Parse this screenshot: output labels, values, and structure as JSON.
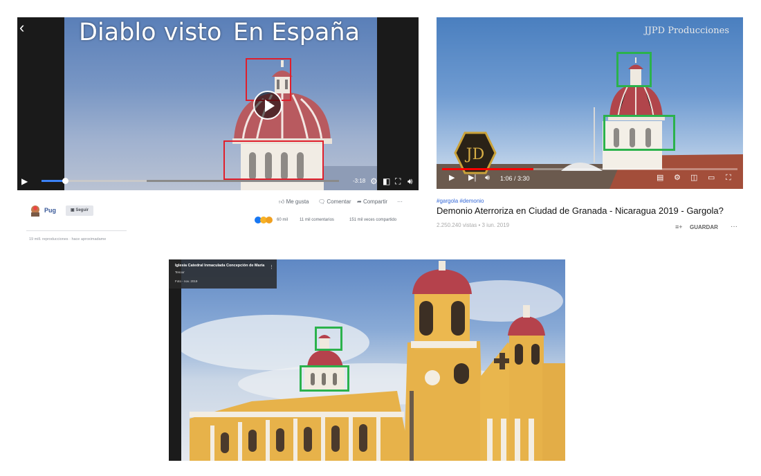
{
  "facebook_video": {
    "caption_left": "Diablo visto",
    "caption_right": "En España",
    "time_remaining": "-3:18",
    "channel_name": "Pug",
    "follow_label": "Seguir",
    "like_label": "Me gusta",
    "comment_label": "Comentar",
    "share_label": "Compartir",
    "more_label": "···",
    "reactions_count": "60 mil",
    "comments_count": "11 mil comentarios",
    "shares_count": "151 mil veces compartido",
    "views_text": "19 mill. reproducciones · hace aproximadame",
    "playback_progress": 0.08
  },
  "youtube_video": {
    "watermark": "JJPD Producciones",
    "time": "1:06 / 3:30",
    "playback_progress": 0.31,
    "tags": "#gargola #demonio",
    "title": "Demonio Aterroriza en Ciudad de Granada - Nicaragua 2019 - Gargola?",
    "stats": "2.250.240 vistas • 3 jun. 2019",
    "save_label": "GUARDAR",
    "more_label": "···"
  },
  "street_view": {
    "place_name": "Iglesia Catedral Inmaculada Concepción de María",
    "subtitle": "Tenoor",
    "date": "Foto - nov. 2019"
  },
  "colors": {
    "highlight_red": "#e01e2b",
    "highlight_green": "#2bb24c",
    "youtube_red": "#ff0000",
    "facebook_blue": "#385898"
  }
}
